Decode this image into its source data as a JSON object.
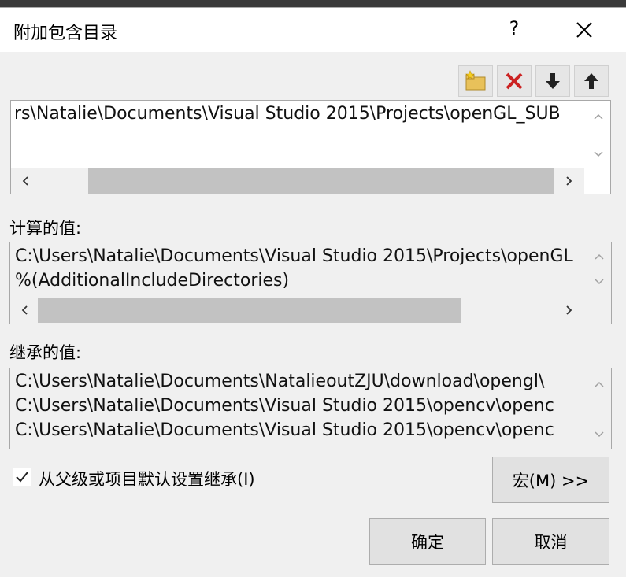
{
  "dialog": {
    "title": "附加包含目录",
    "help_label": "?"
  },
  "toolbar": {
    "new_line_icon": "folder-new-icon",
    "delete_icon": "delete-x-icon",
    "move_down_icon": "arrow-down-icon",
    "move_up_icon": "arrow-up-icon"
  },
  "edit_box": {
    "lines": [
      "rs\\Natalie\\Documents\\Visual Studio 2015\\Projects\\openGL_SUB"
    ]
  },
  "evaluated": {
    "label": "计算的值:",
    "lines": [
      "C:\\Users\\Natalie\\Documents\\Visual Studio 2015\\Projects\\openGL",
      "%(AdditionalIncludeDirectories)"
    ]
  },
  "inherited": {
    "label": "继承的值:",
    "lines": [
      "C:\\Users\\Natalie\\Documents\\NatalieoutZJU\\download\\opengl\\",
      "C:\\Users\\Natalie\\Documents\\Visual Studio 2015\\opencv\\openc",
      "C:\\Users\\Natalie\\Documents\\Visual Studio 2015\\opencv\\openc"
    ]
  },
  "inherit_checkbox": {
    "label": "从父级或项目默认设置继承(I)",
    "checked": true
  },
  "buttons": {
    "macros": "宏(M) >>",
    "ok": "确定",
    "cancel": "取消"
  },
  "colors": {
    "delete_red": "#cc2222",
    "folder_yellow": "#e8c15a"
  }
}
